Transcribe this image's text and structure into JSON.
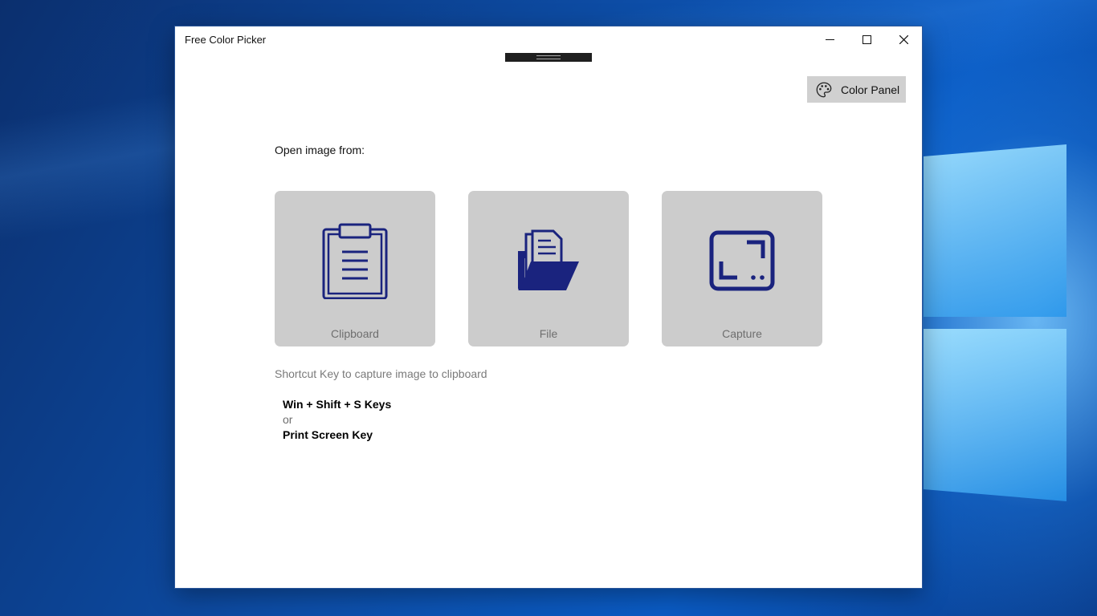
{
  "window": {
    "title": "Free Color Picker"
  },
  "toolbar": {
    "color_panel_label": "Color Panel"
  },
  "main": {
    "open_label": "Open image from:",
    "tiles": [
      {
        "label": "Clipboard",
        "icon": "clipboard-icon"
      },
      {
        "label": "File",
        "icon": "folder-icon"
      },
      {
        "label": "Capture",
        "icon": "capture-icon"
      }
    ],
    "shortcut_hint": "Shortcut Key to capture image to clipboard",
    "shortcut_primary": "Win + Shift + S Keys",
    "shortcut_or": "or",
    "shortcut_secondary": "Print Screen Key"
  },
  "colors": {
    "icon_color": "#1a237e",
    "tile_bg": "#cccccc",
    "button_bg": "#d0d0d0"
  }
}
